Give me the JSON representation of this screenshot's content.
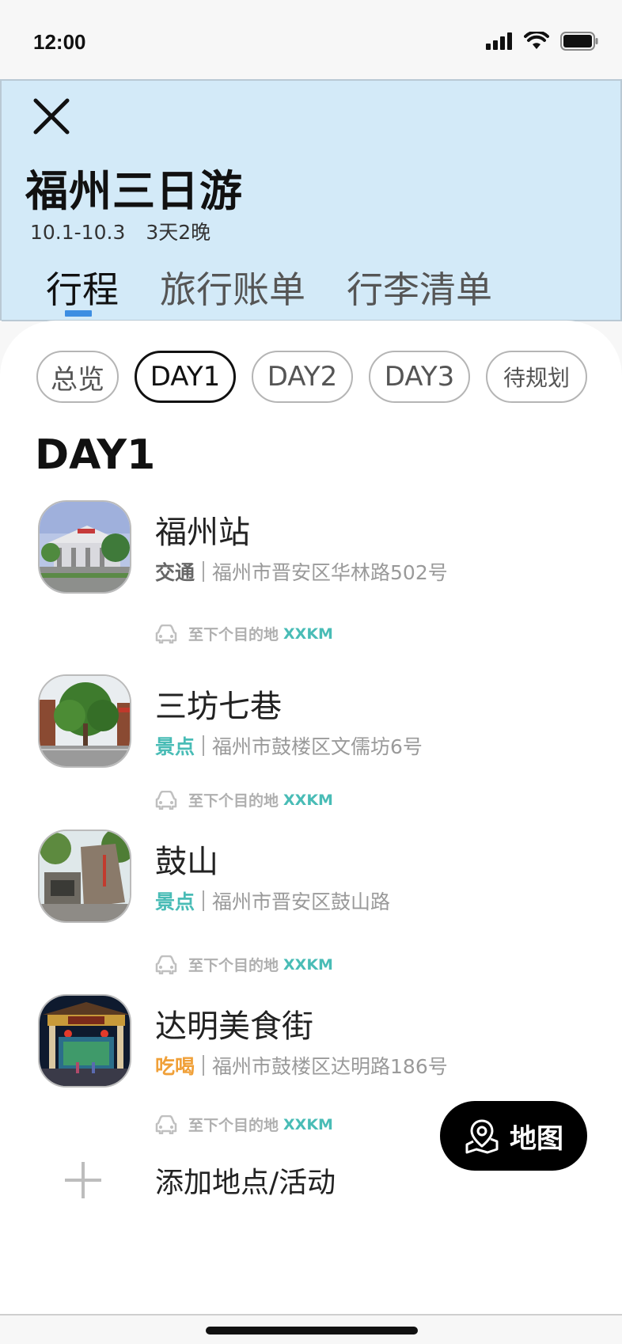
{
  "status_bar": {
    "time": "12:00",
    "icons": [
      "signal-icon",
      "wifi-icon",
      "battery-icon"
    ]
  },
  "header": {
    "close_icon": "close-icon",
    "title": "福州三日游",
    "dates": "10.1-10.3",
    "duration": "3天2晚",
    "tabs": [
      {
        "label": "行程",
        "active": true
      },
      {
        "label": "旅行账单",
        "active": false
      },
      {
        "label": "行李清单",
        "active": false
      }
    ]
  },
  "day_pills": [
    {
      "label": "总览",
      "active": false
    },
    {
      "label": "DAY1",
      "active": true
    },
    {
      "label": "DAY2",
      "active": false
    },
    {
      "label": "DAY3",
      "active": false
    },
    {
      "label": "待规划",
      "active": false
    }
  ],
  "day_heading": "DAY1",
  "places": [
    {
      "name": "福州站",
      "category": "交通",
      "category_color": "#666666",
      "address": "福州市晋安区华林路502号",
      "next_label": "至下个目的地",
      "next_distance": "XXKM",
      "thumb": "train-station-photo"
    },
    {
      "name": "三坊七巷",
      "category": "景点",
      "category_color": "#49bcb6",
      "address": "福州市鼓楼区文儒坊6号",
      "next_label": "至下个目的地",
      "next_distance": "XXKM",
      "thumb": "old-street-photo"
    },
    {
      "name": "鼓山",
      "category": "景点",
      "category_color": "#49bcb6",
      "address": "福州市晋安区鼓山路",
      "next_label": "至下个目的地",
      "next_distance": "XXKM",
      "thumb": "mountain-rock-photo"
    },
    {
      "name": "达明美食街",
      "category": "吃喝",
      "category_color": "#f0a038",
      "address": "福州市鼓楼区达明路186号",
      "next_label": "至下个目的地",
      "next_distance": "XXKM",
      "thumb": "food-street-gate-photo"
    }
  ],
  "add_place": {
    "icon": "plus-icon",
    "label": "添加地点/活动"
  },
  "map_button": {
    "icon": "map-pin-icon",
    "label": "地图"
  },
  "colors": {
    "header_bg": "#d3eaf8",
    "tab_indicator": "#3d8ee2",
    "scenic": "#49bcb6",
    "food": "#f0a038",
    "distance": "#49bcb6"
  }
}
